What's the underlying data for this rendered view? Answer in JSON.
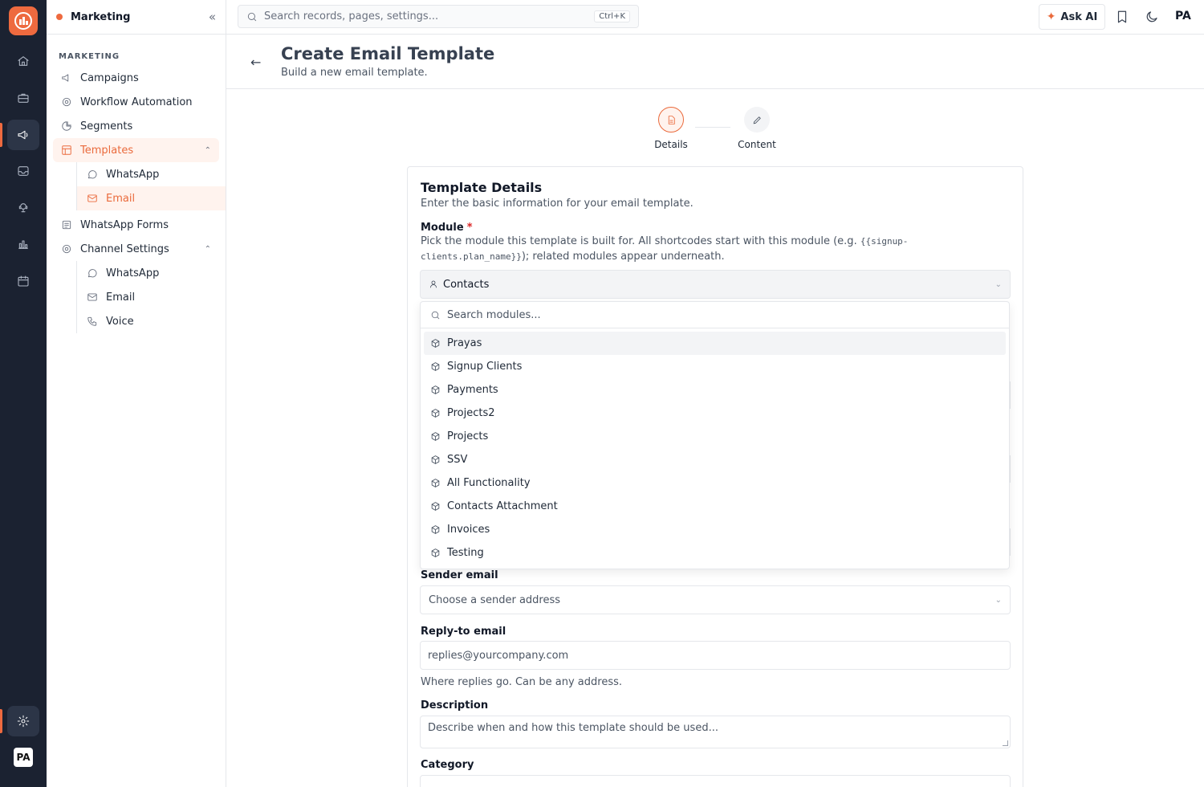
{
  "rail": {
    "avatar_initials": "PA",
    "icons": [
      "home-icon",
      "briefcase-icon",
      "megaphone-icon",
      "inbox-icon",
      "support-icon",
      "chart-icon",
      "calendar-icon",
      "settings-icon"
    ]
  },
  "sidebar": {
    "workspace": "Marketing",
    "section_label": "MARKETING",
    "items": [
      {
        "label": "Campaigns"
      },
      {
        "label": "Workflow Automation"
      },
      {
        "label": "Segments"
      },
      {
        "label": "Templates"
      },
      {
        "label": "WhatsApp"
      },
      {
        "label": "Email"
      },
      {
        "label": "WhatsApp Forms"
      },
      {
        "label": "Channel Settings"
      },
      {
        "label": "WhatsApp"
      },
      {
        "label": "Email"
      },
      {
        "label": "Voice"
      }
    ]
  },
  "topbar": {
    "search_placeholder": "Search records, pages, settings...",
    "shortcut": "Ctrl+K",
    "ask_ai": "Ask AI",
    "avatar_initials": "PA"
  },
  "page": {
    "title": "Create Email Template",
    "subtitle": "Build a new email template."
  },
  "stepper": {
    "steps": [
      {
        "label": "Details",
        "active": true
      },
      {
        "label": "Content",
        "active": false
      }
    ]
  },
  "form": {
    "card_title": "Template Details",
    "card_desc": "Enter the basic information for your email template.",
    "module_label": "Module",
    "module_help_pre": "Pick the module this template is built for. All shortcodes start with this module (e.g. ",
    "module_help_code": "{{signup-clients.plan_name}}",
    "module_help_post": "); related modules appear underneath.",
    "module_value": "Contacts",
    "sender_label": "Sender email",
    "sender_placeholder": "Choose a sender address",
    "reply_label": "Reply-to email",
    "reply_placeholder": "replies@yourcompany.com",
    "reply_help": "Where replies go. Can be any address.",
    "desc_label": "Description",
    "desc_placeholder": "Describe when and how this template should be used...",
    "category_label": "Category"
  },
  "dropdown": {
    "search_placeholder": "Search modules...",
    "options": [
      "Prayas",
      "Signup Clients",
      "Payments",
      "Projects2",
      "Projects",
      "SSV",
      "All Functionality",
      "Contacts Attachment",
      "Invoices",
      "Testing"
    ],
    "highlighted_index": 0
  },
  "colors": {
    "accent": "#ea6a3c",
    "rail_bg": "#1b2231"
  }
}
